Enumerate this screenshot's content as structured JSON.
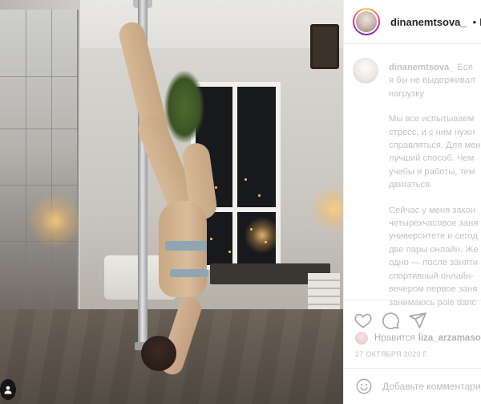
{
  "post": {
    "username": "dinanemtsova_",
    "separator": "•",
    "follow_label": "П",
    "caption_author": "dinanemtsova_",
    "caption_lines": [
      "Есл",
      "я бы не выдерживал",
      "нагрузку",
      "Мы все испытываем",
      "стресс, и с ним нужн",
      "справляться. Для мен",
      "лучший способ. Чем",
      "учебы и работы, тем",
      "двигаться.",
      "Сейчас у меня закон",
      "четырехчасовое заня",
      "университете и сегод",
      "две пары онлайн. Же",
      "одно — после заняти",
      "спортивный онлайн-",
      "вечером первое заня",
      "занимаюсь pole danc"
    ],
    "liked_by_prefix": "Нравится",
    "liked_by_user": "liza_arzamasov",
    "date": "27 ОКТЯБРЯ 2020 Г.",
    "comment_placeholder": "Добавьте комментари"
  },
  "icons": {
    "like": "heart-icon",
    "comment": "comment-bubble-icon",
    "share": "paper-plane-icon",
    "emoji": "smiley-icon",
    "verified": "verified-badge-icon",
    "tagged_users": "user-tag-icon"
  },
  "colors": {
    "verified": "#3897f0",
    "text": "#262626",
    "muted": "#8e8e8e",
    "border": "#efefef"
  }
}
